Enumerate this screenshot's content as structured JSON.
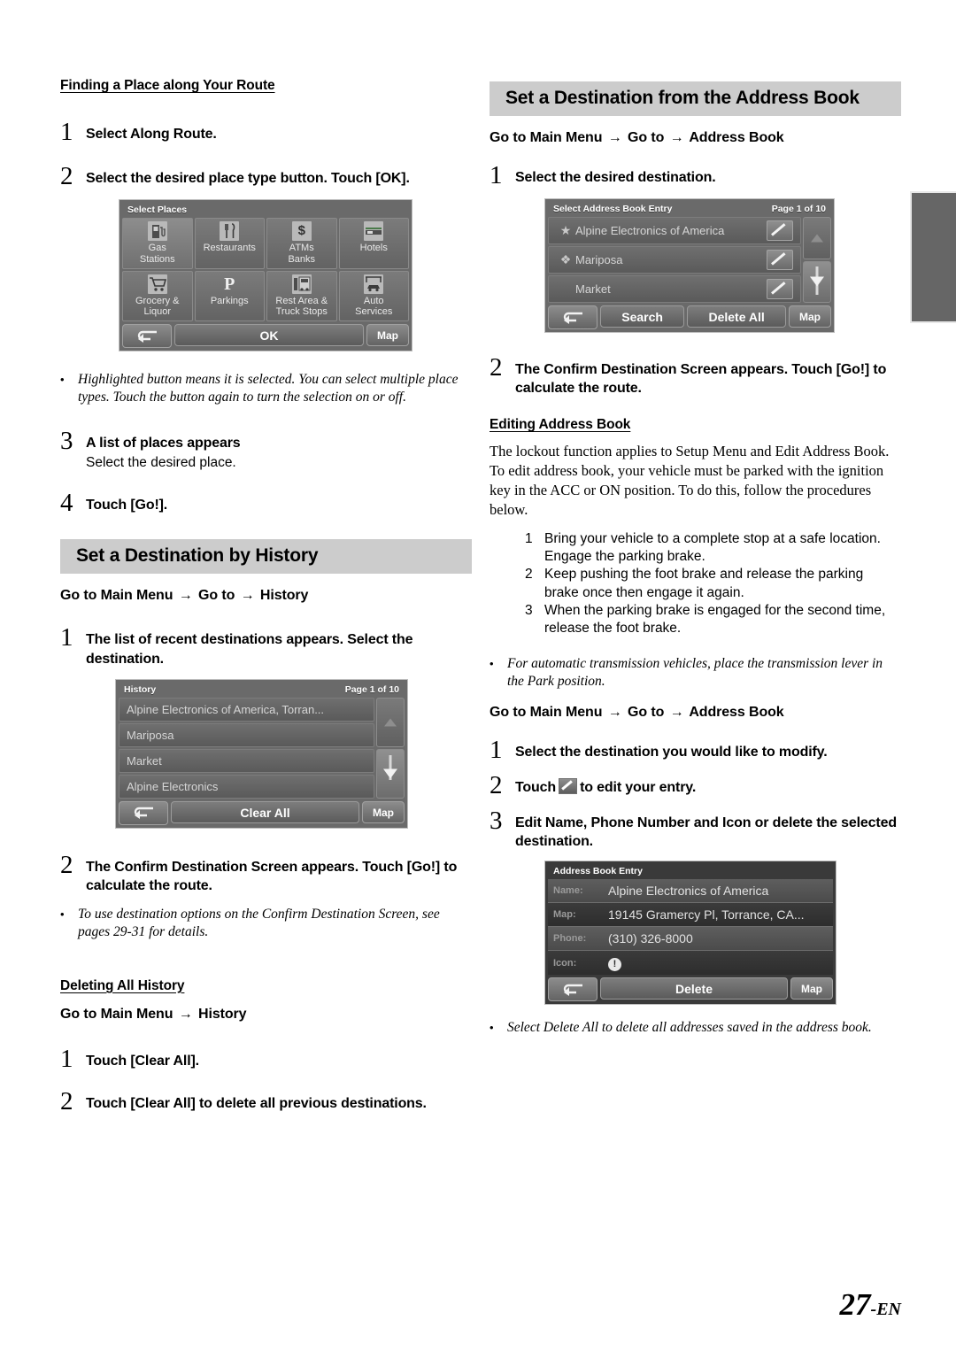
{
  "page": {
    "number": "27",
    "suffix": "-EN"
  },
  "left_column": {
    "heading1": "Finding a Place along Your Route",
    "step1": {
      "num": "1",
      "text": "Select Along Route."
    },
    "step2": {
      "num": "2",
      "text": "Select the desired place type button. Touch [OK]."
    },
    "select_places_screen": {
      "title": "Select Places",
      "buttons": [
        {
          "label_line1": "Gas",
          "label_line2": "Stations",
          "icon": "gas-pump-icon",
          "selected": true
        },
        {
          "label_line1": "Restaurants",
          "label_line2": "",
          "icon": "fork-knife-icon",
          "selected": false
        },
        {
          "label_line1": "ATMs",
          "label_line2": "Banks",
          "icon": "dollar-sign-icon",
          "selected": false
        },
        {
          "label_line1": "Hotels",
          "label_line2": "",
          "icon": "bed-icon",
          "selected": false
        },
        {
          "label_line1": "Grocery &",
          "label_line2": "Liquor",
          "icon": "shopping-cart-icon",
          "selected": false
        },
        {
          "label_line1": "Parkings",
          "label_line2": "",
          "icon": "parking-p-icon",
          "selected": false
        },
        {
          "label_line1": "Rest Area &",
          "label_line2": "Truck Stops",
          "icon": "rest-area-icon",
          "selected": false
        },
        {
          "label_line1": "Auto",
          "label_line2": "Services",
          "icon": "auto-service-icon",
          "selected": false
        }
      ],
      "ok_label": "OK",
      "map_label": "Map",
      "back_label": "back-arrow-icon"
    },
    "note1": "Highlighted button means it is selected. You can select multiple place types. Touch the button again to turn the selection on or off.",
    "step3": {
      "num": "3",
      "text": "A list of places appears",
      "sub": "Select the desired place."
    },
    "step4": {
      "num": "4",
      "text": "Touch [Go!]."
    },
    "heading2": "Set a Destination by History",
    "path2": {
      "p1": "Go to Main Menu",
      "p2": "Go to",
      "p3": "History"
    },
    "step5": {
      "num": "1",
      "text": "The list of recent destinations appears. Select the destination."
    },
    "history_screen": {
      "title": "History",
      "page_label": "Page 1 of 10",
      "rows": [
        "Alpine Electronics of America, Torran...",
        "Mariposa",
        "Market",
        "Alpine Electronics"
      ],
      "clear_all_label": "Clear All",
      "map_label": "Map"
    },
    "step6": {
      "num": "2",
      "text": "The Confirm Destination Screen appears. Touch [Go!] to calculate the route."
    },
    "note2": "To use destination options on the Confirm Destination Screen, see pages 29-31 for details.",
    "heading3": "Deleting All History",
    "path3": {
      "p1": "Go to Main Menu",
      "p2": "History"
    },
    "step7": {
      "num": "1",
      "text": "Touch [Clear All]."
    },
    "step8": {
      "num": "2",
      "text": "Touch [Clear All] to delete all previous destinations."
    }
  },
  "right_column": {
    "heading1": "Set a Destination from the Address Book",
    "path1": {
      "p1": "Go to Main Menu",
      "p2": "Go to",
      "p3": "Address Book"
    },
    "step1": {
      "num": "1",
      "text": "Select the desired destination."
    },
    "address_book_list_screen": {
      "title": "Select Address Book Entry",
      "page_label": "Page 1 of 10",
      "rows": [
        {
          "icon": "star-icon",
          "text": "Alpine Electronics of America"
        },
        {
          "icon": "pin-icon",
          "text": "Mariposa"
        },
        {
          "icon": "",
          "text": "Market"
        }
      ],
      "search_label": "Search",
      "delete_all_label": "Delete All",
      "map_label": "Map"
    },
    "step2": {
      "num": "2",
      "text": "The Confirm Destination Screen appears. Touch [Go!] to calculate the route."
    },
    "heading2": "Editing Address Book",
    "para1": "The lockout function applies to Setup Menu and Edit Address Book. To edit address book, your vehicle must be parked with the ignition key in the ACC or ON position. To do this, follow the procedures below.",
    "procedures": [
      {
        "n": "1",
        "text": "Bring your vehicle to a complete stop at a safe location. Engage the parking brake."
      },
      {
        "n": "2",
        "text": "Keep pushing the foot brake and release the parking brake once then engage it again."
      },
      {
        "n": "3",
        "text": "When the parking brake is engaged for the second time, release the foot brake."
      }
    ],
    "note1": "For automatic transmission vehicles, place the transmission lever in the Park position.",
    "path2": {
      "p1": "Go to Main Menu",
      "p2": "Go to",
      "p3": "Address Book"
    },
    "step3": {
      "num": "1",
      "text": "Select the destination you would like to modify."
    },
    "step4": {
      "num": "2",
      "text_before": "Touch",
      "text_after": "to edit your entry.",
      "icon": "pencil-edit-icon"
    },
    "step5": {
      "num": "3",
      "text": "Edit Name, Phone Number and Icon or delete the selected destination."
    },
    "address_book_entry_screen": {
      "title": "Address Book Entry",
      "fields": [
        {
          "label": "Name:",
          "value": "Alpine Electronics of America"
        },
        {
          "label": "Map:",
          "value": "19145 Gramercy Pl, Torrance, CA..."
        },
        {
          "label": "Phone:",
          "value": "(310) 326-8000"
        },
        {
          "label": "Icon:",
          "value": ""
        }
      ],
      "delete_label": "Delete",
      "map_label": "Map"
    },
    "note2": "Select Delete All to delete all addresses saved in the address book."
  }
}
